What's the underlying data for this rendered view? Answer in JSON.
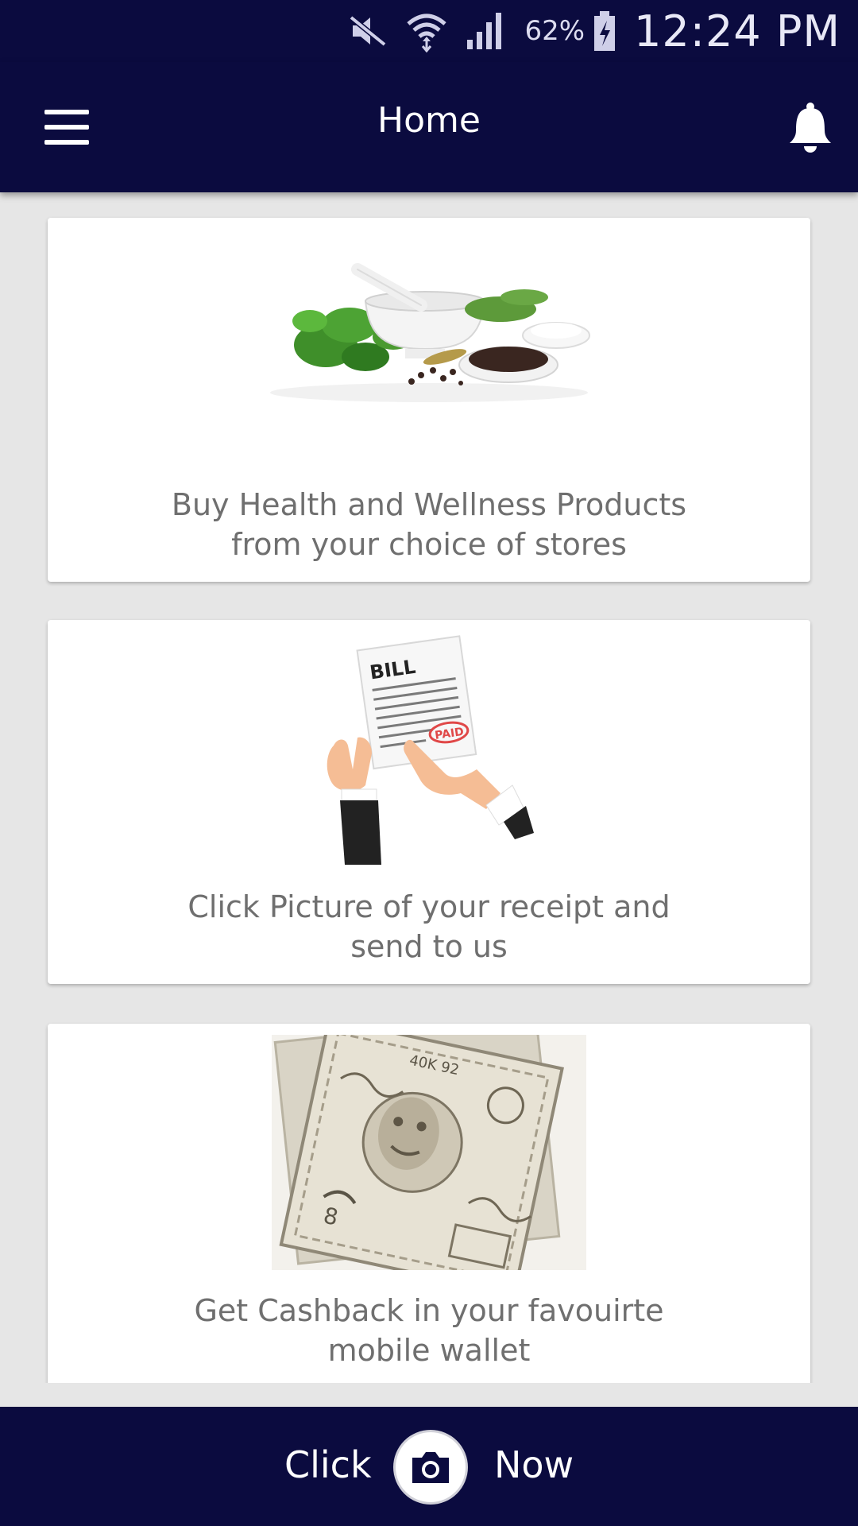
{
  "status_bar": {
    "battery": "62%",
    "time": "12:24 PM",
    "icons": [
      "mute-icon",
      "wifi-icon",
      "signal-icon",
      "battery-charging-icon"
    ]
  },
  "app_bar": {
    "title": "Home",
    "left_icon": "hamburger-menu-icon",
    "right_icon": "bell-icon"
  },
  "cards": [
    {
      "image": "herbs-mortar-pestle-image",
      "line1": "Buy Health and Wellness Products",
      "line2": "from your choice of stores"
    },
    {
      "image": "bill-paid-hands-image",
      "line1": "Click Picture of your receipt and",
      "line2": "send to us"
    },
    {
      "image": "rupee-banknote-image",
      "line1": "Get Cashback in your favouirte",
      "line2": "mobile wallet"
    }
  ],
  "bottom_bar": {
    "left_label": "Click",
    "right_label": "Now",
    "icon": "camera-icon"
  },
  "colors": {
    "primary": "#0b0b3f",
    "background": "#e6e6e6",
    "card": "#ffffff",
    "text": "#6f6f6f"
  }
}
